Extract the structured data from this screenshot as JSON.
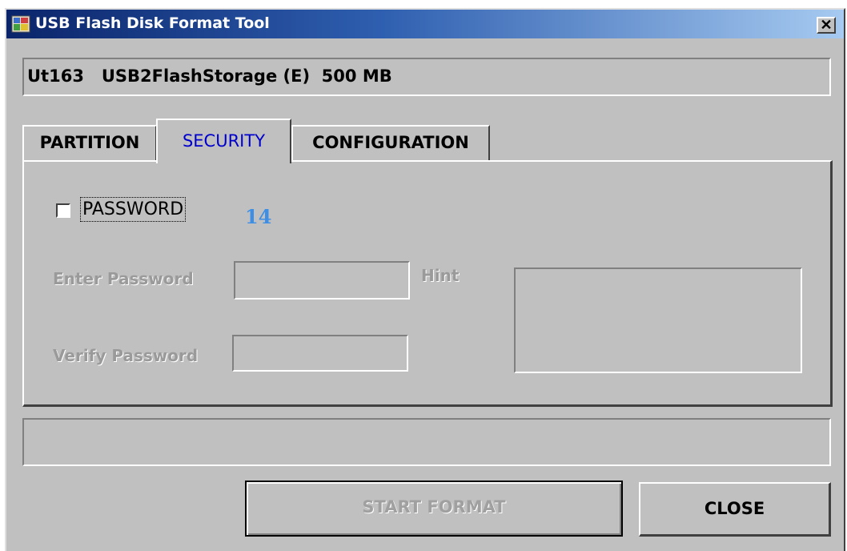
{
  "window": {
    "title": "USB Flash Disk Format Tool",
    "close_glyph": "✕",
    "icon": "usb-app-icon"
  },
  "device": {
    "text": "Ut163   USB2FlashStorage (E)  500 MB"
  },
  "tabs": [
    {
      "label": "PARTITION",
      "active": false
    },
    {
      "label": "SECURITY",
      "active": true
    },
    {
      "label": "CONFIGURATION",
      "active": false
    }
  ],
  "security": {
    "password_checkbox_label": "PASSWORD",
    "password_checked": false,
    "annotation": "14",
    "enter_password_label": "Enter Password",
    "enter_password_value": "",
    "verify_password_label": "Verify Password",
    "verify_password_value": "",
    "hint_label": "Hint",
    "hint_value": ""
  },
  "status": {
    "text": ""
  },
  "buttons": {
    "start_format": "START FORMAT",
    "close": "CLOSE"
  },
  "colors": {
    "face": "#c0c0c0",
    "title_gradient_start": "#0a246a",
    "title_gradient_end": "#a6caf0",
    "active_tab_text": "#0000cc",
    "annotation": "#3d8fe6",
    "disabled_text": "#9a9a9a"
  }
}
